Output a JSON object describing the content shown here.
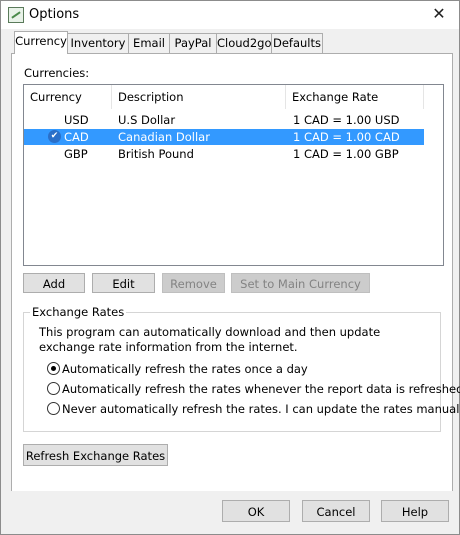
{
  "window": {
    "title": "Options",
    "icon": "options-app-icon",
    "close_icon": "close-icon",
    "close_glyph": "✕"
  },
  "tabs": [
    {
      "label": "Currency",
      "active": true
    },
    {
      "label": "Inventory",
      "active": false
    },
    {
      "label": "Email",
      "active": false
    },
    {
      "label": "PayPal",
      "active": false
    },
    {
      "label": "Cloud2go",
      "active": false
    },
    {
      "label": "Defaults",
      "active": false
    }
  ],
  "currency": {
    "currencies_label": "Currencies:",
    "columns": [
      "Currency",
      "Description",
      "Exchange Rate"
    ],
    "rows": [
      {
        "code": "USD",
        "description": "U.S Dollar",
        "rate": "1 CAD = 1.00 USD",
        "selected": false,
        "main": false
      },
      {
        "code": "CAD",
        "description": "Canadian Dollar",
        "rate": "1 CAD = 1.00 CAD",
        "selected": true,
        "main": true
      },
      {
        "code": "GBP",
        "description": "British Pound",
        "rate": "1 CAD = 1.00 GBP",
        "selected": false,
        "main": false
      }
    ],
    "main_check_glyph": "✔",
    "buttons": {
      "add": "Add",
      "edit": "Edit",
      "remove": "Remove",
      "set_main": "Set to Main Currency"
    },
    "exchange_rates": {
      "title": "Exchange Rates",
      "description": "This program can automatically download and then update exchange rate information from the internet.",
      "options": [
        {
          "label": "Automatically refresh the rates once a day",
          "checked": true
        },
        {
          "label": "Automatically refresh the rates whenever the report data is refreshed.",
          "checked": false
        },
        {
          "label": "Never automatically refresh the rates. I can update the rates manually.",
          "checked": false
        }
      ]
    },
    "refresh_button": "Refresh Exchange Rates"
  },
  "footer": {
    "ok": "OK",
    "cancel": "Cancel",
    "help": "Help"
  },
  "colors": {
    "selection": "#3399ff",
    "window_bg": "#f0f0f0",
    "panel_bg": "#ffffff"
  }
}
